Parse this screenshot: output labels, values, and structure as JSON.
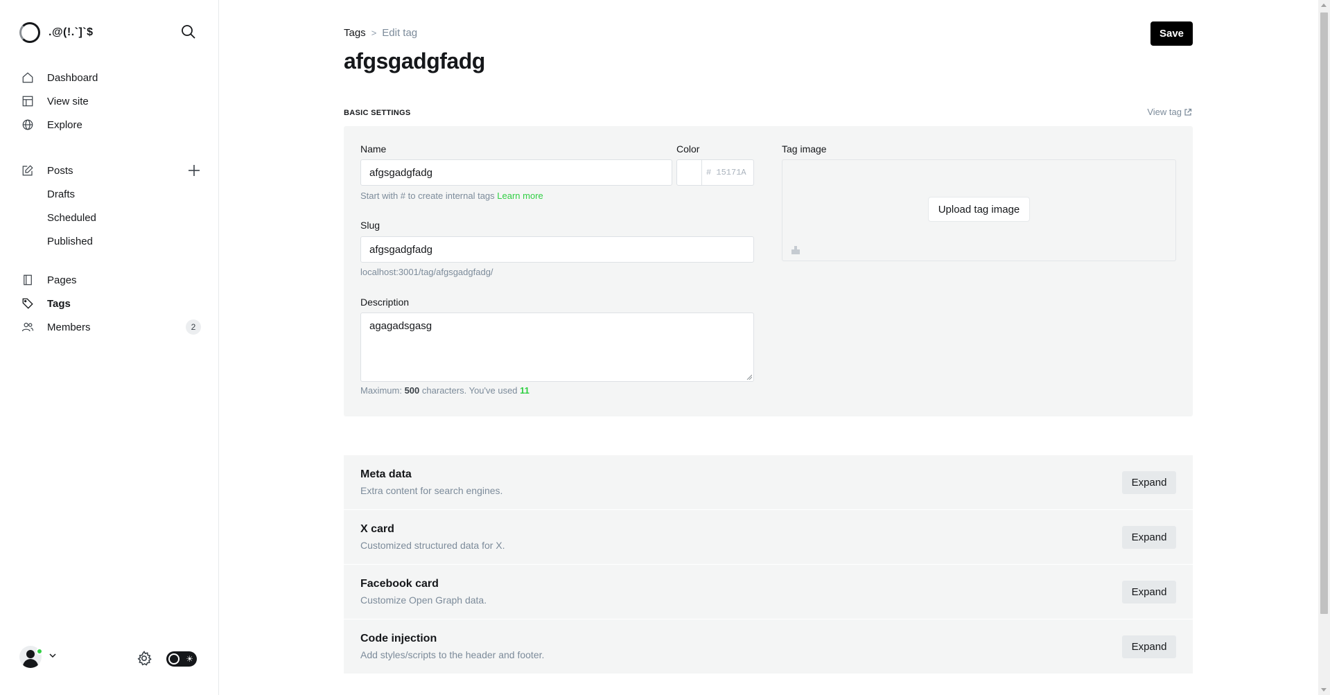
{
  "app": {
    "site_name": ".@(!.`]`$"
  },
  "sidebar": {
    "primary": [
      {
        "label": "Dashboard",
        "icon": "home-icon"
      },
      {
        "label": "View site",
        "icon": "layout-icon"
      },
      {
        "label": "Explore",
        "icon": "globe-icon"
      }
    ],
    "posts": {
      "label": "Posts",
      "sub": [
        "Drafts",
        "Scheduled",
        "Published"
      ]
    },
    "secondary": [
      {
        "label": "Pages",
        "icon": "page-icon"
      },
      {
        "label": "Tags",
        "icon": "tag-icon"
      },
      {
        "label": "Members",
        "icon": "members-icon",
        "count": "2"
      }
    ],
    "active": "Tags"
  },
  "breadcrumb": {
    "parent": "Tags",
    "separator": ">",
    "current": "Edit tag"
  },
  "page": {
    "title": "afgsgadgfadg",
    "save_label": "Save",
    "section_label": "BASIC SETTINGS",
    "view_tag_label": "View tag"
  },
  "form": {
    "name_label": "Name",
    "name_value": "afgsgadgfadg",
    "name_hint": "Start with # to create internal tags",
    "name_hint_link": "Learn more",
    "color_label": "Color",
    "color_placeholder": "# 15171A",
    "slug_label": "Slug",
    "slug_value": "afgsgadgfadg",
    "slug_url": "localhost:3001/tag/afgsgadgfadg/",
    "description_label": "Description",
    "description_value": "agagadsgasg",
    "desc_hint_prefix": "Maximum:",
    "desc_hint_max": "500",
    "desc_hint_middle": "characters. You've used",
    "desc_hint_used": "11",
    "tag_image_label": "Tag image",
    "upload_label": "Upload tag image"
  },
  "expanders": [
    {
      "title": "Meta data",
      "desc": "Extra content for search engines.",
      "button": "Expand"
    },
    {
      "title": "X card",
      "desc": "Customized structured data for X.",
      "button": "Expand"
    },
    {
      "title": "Facebook card",
      "desc": "Customize Open Graph data.",
      "button": "Expand"
    },
    {
      "title": "Code injection",
      "desc": "Add styles/scripts to the header and footer.",
      "button": "Expand"
    }
  ],
  "colors": {
    "accent_green": "#30cf43",
    "text": "#15171a",
    "muted": "#7c8b9a",
    "panel": "#f4f5f5"
  }
}
